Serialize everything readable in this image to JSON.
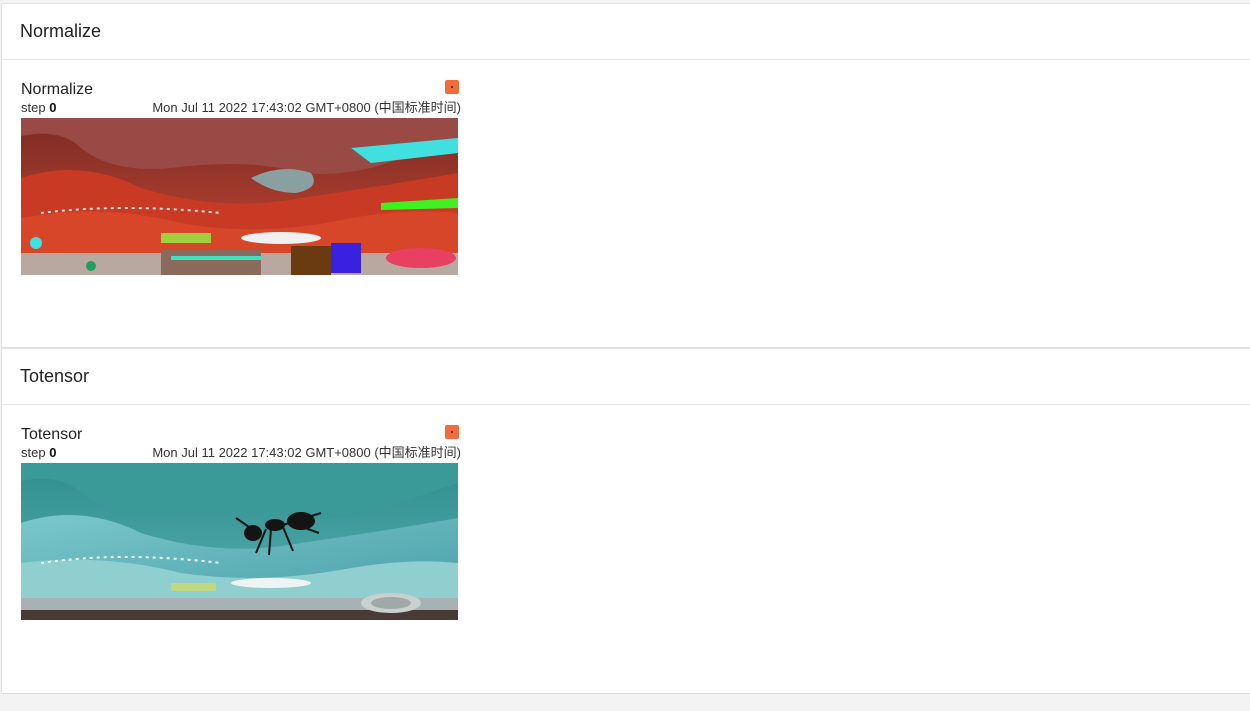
{
  "sections": [
    {
      "header": "Normalize",
      "card": {
        "title": "Normalize",
        "step_label": "step",
        "step_value": "0",
        "timestamp": "Mon Jul 11 2022 17:43:02 GMT+0800 (中国标准时间)",
        "image_kind": "normalized ant photo (false-color)"
      }
    },
    {
      "header": "Totensor",
      "card": {
        "title": "Totensor",
        "step_label": "step",
        "step_value": "0",
        "timestamp": "Mon Jul 11 2022 17:43:02 GMT+0800 (中国标准时间)",
        "image_kind": "ant on blue surface photo"
      }
    }
  ],
  "colors": {
    "menu_accent": "#f36c3c",
    "page_bg": "#f3f3f3",
    "panel_bg": "#ffffff"
  }
}
